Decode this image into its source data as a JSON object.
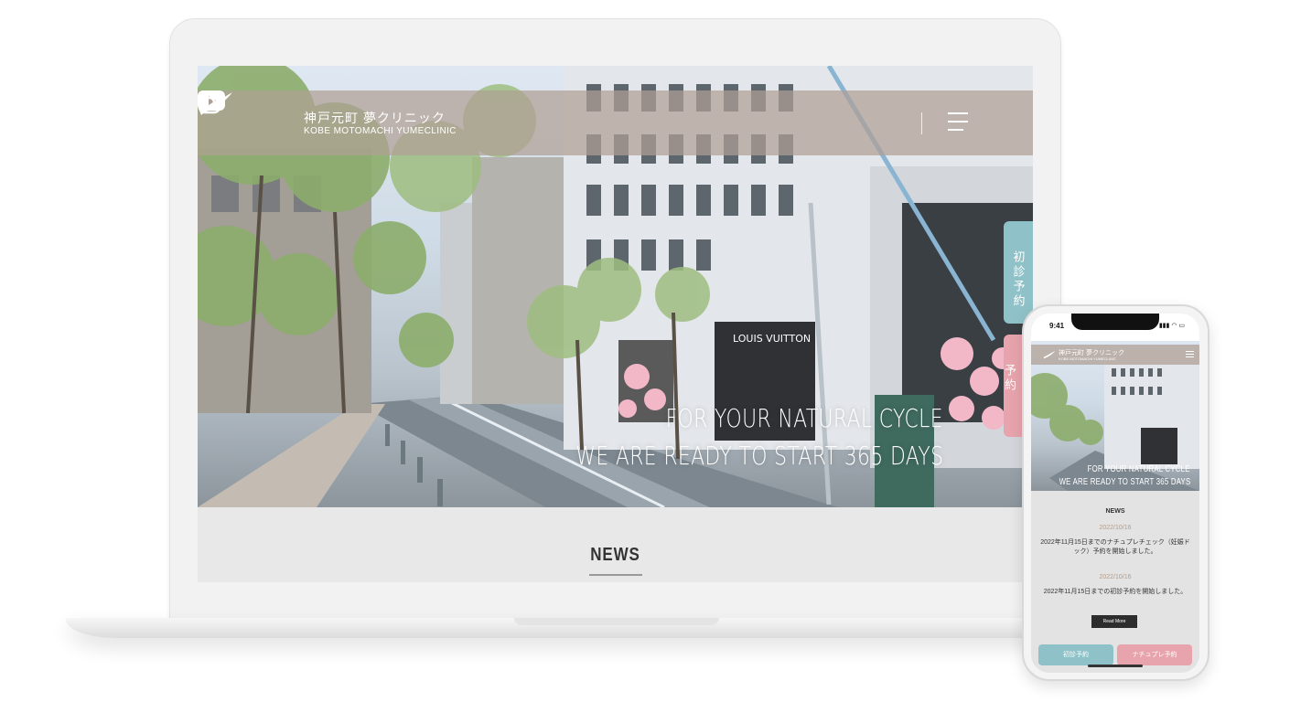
{
  "site": {
    "logo_jp": "神戸元町 夢クリニック",
    "logo_en": "KOBE MOTOMACHI YUMECLINIC"
  },
  "header": {
    "icons": [
      "youtube-icon",
      "instagram-icon",
      "menu-icon"
    ]
  },
  "side_tabs": {
    "first_visit": "初診予約",
    "checkup": "ナチュプレ予約"
  },
  "hero": {
    "tagline_1": "FOR YOUR NATURAL CYCLE",
    "tagline_2": "WE ARE READY TO START 365 DAYS",
    "store_sign": "LOUIS VUITTON"
  },
  "news": {
    "title": "NEWS"
  },
  "phone": {
    "status_time": "9:41",
    "news_title": "NEWS",
    "items": [
      {
        "date": "2022/10/16",
        "text": "2022年11月15日までのナチュプレチェック（妊娠ドック）予約を開始しました。"
      },
      {
        "date": "2022/10/16",
        "text": "2022年11月15日までの初診予約を開始しました。"
      }
    ],
    "read_more": "Read More",
    "btn_first_visit": "初診予約",
    "btn_checkup": "ナチュプレ予約"
  },
  "colors": {
    "teal": "#8fc2c8",
    "pink": "#e8a4ac",
    "header_taupe": "#b0a096",
    "date_color": "#b29c8c"
  }
}
